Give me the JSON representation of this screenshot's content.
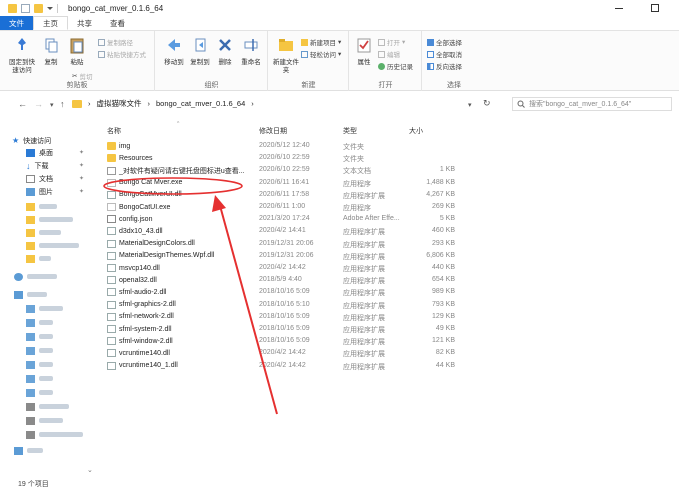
{
  "window": {
    "title": "bongo_cat_mver_0.1.6_64"
  },
  "tabs": [
    "文件",
    "主页",
    "共享",
    "查看"
  ],
  "ribbon": {
    "pin_label": "固定到快速访问",
    "copy_label": "复制",
    "paste_label": "粘贴",
    "copy_path_label": "复制路径",
    "paste_shortcut_label": "粘贴快捷方式",
    "cut_label": "剪切",
    "clipboard_group": "剪贴板",
    "move_to_label": "移动到",
    "copy_to_label": "复制到",
    "delete_label": "删除",
    "rename_label": "重命名",
    "organize_group": "组织",
    "new_folder_label": "新建文件夹",
    "new_item_label": "新建项目",
    "easy_access_label": "轻松访问",
    "new_group": "新建",
    "properties_label": "属性",
    "open_label": "打开",
    "edit_label": "编辑",
    "history_label": "历史记录",
    "open_group": "打开",
    "select_all_label": "全部选择",
    "select_none_label": "全部取消",
    "invert_selection_label": "反向选择",
    "select_group": "选择"
  },
  "address": {
    "crumbs": [
      "虚拟猫咪文件",
      "bongo_cat_mver_0.1.6_64"
    ],
    "search_placeholder": "搜索\"bongo_cat_mver_0.1.6_64\""
  },
  "nav": {
    "quick_access": "快速访问",
    "items": [
      "桌面",
      "下载",
      "文档",
      "图片"
    ]
  },
  "columns": {
    "name": "名称",
    "date": "修改日期",
    "type": "类型",
    "size": "大小"
  },
  "files": [
    {
      "icon": "folder",
      "name": "img",
      "date": "2020/5/12 12:40",
      "type": "文件夹",
      "size": ""
    },
    {
      "icon": "folder",
      "name": "Resources",
      "date": "2020/6/10 22:59",
      "type": "文件夹",
      "size": ""
    },
    {
      "icon": "doc",
      "name": "_对软件有疑问请右键托盘图标进u查看...",
      "date": "2020/6/10 22:59",
      "type": "文本文档",
      "size": "1 KB"
    },
    {
      "icon": "exe",
      "name": "Bongo Cat Mver.exe",
      "date": "2020/6/11 16:41",
      "type": "应用程序",
      "size": "1,488 KB"
    },
    {
      "icon": "dll",
      "name": "BongoCatMverUI.dll",
      "date": "2020/6/11 17:58",
      "type": "应用程序扩展",
      "size": "4,267 KB"
    },
    {
      "icon": "exe",
      "name": "BongoCatUI.exe",
      "date": "2020/6/11 1:00",
      "type": "应用程序",
      "size": "269 KB"
    },
    {
      "icon": "json",
      "name": "config.json",
      "date": "2021/3/20 17:24",
      "type": "Adobe After Effe...",
      "size": "5 KB"
    },
    {
      "icon": "dll",
      "name": "d3dx10_43.dll",
      "date": "2020/4/2 14:41",
      "type": "应用程序扩展",
      "size": "460 KB"
    },
    {
      "icon": "dll",
      "name": "MaterialDesignColors.dll",
      "date": "2019/12/31 20:06",
      "type": "应用程序扩展",
      "size": "293 KB"
    },
    {
      "icon": "dll",
      "name": "MaterialDesignThemes.Wpf.dll",
      "date": "2019/12/31 20:06",
      "type": "应用程序扩展",
      "size": "6,806 KB"
    },
    {
      "icon": "dll",
      "name": "msvcp140.dll",
      "date": "2020/4/2 14:42",
      "type": "应用程序扩展",
      "size": "440 KB"
    },
    {
      "icon": "dll",
      "name": "openal32.dll",
      "date": "2018/5/9 4:40",
      "type": "应用程序扩展",
      "size": "654 KB"
    },
    {
      "icon": "dll",
      "name": "sfml-audio-2.dll",
      "date": "2018/10/16 5:09",
      "type": "应用程序扩展",
      "size": "989 KB"
    },
    {
      "icon": "dll",
      "name": "sfml-graphics-2.dll",
      "date": "2018/10/16 5:10",
      "type": "应用程序扩展",
      "size": "793 KB"
    },
    {
      "icon": "dll",
      "name": "sfml-network-2.dll",
      "date": "2018/10/16 5:09",
      "type": "应用程序扩展",
      "size": "129 KB"
    },
    {
      "icon": "dll",
      "name": "sfml-system-2.dll",
      "date": "2018/10/16 5:09",
      "type": "应用程序扩展",
      "size": "49 KB"
    },
    {
      "icon": "dll",
      "name": "sfml-window-2.dll",
      "date": "2018/10/16 5:09",
      "type": "应用程序扩展",
      "size": "121 KB"
    },
    {
      "icon": "dll",
      "name": "vcruntime140.dll",
      "date": "2020/4/2 14:42",
      "type": "应用程序扩展",
      "size": "82 KB"
    },
    {
      "icon": "dll",
      "name": "vcruntime140_1.dll",
      "date": "2020/4/2 14:42",
      "type": "应用程序扩展",
      "size": "44 KB"
    }
  ],
  "status": {
    "count": "19 个项目"
  },
  "colors": {
    "accent": "#1a6fd6",
    "folder": "#f5c542",
    "annotation": "#e53030"
  }
}
